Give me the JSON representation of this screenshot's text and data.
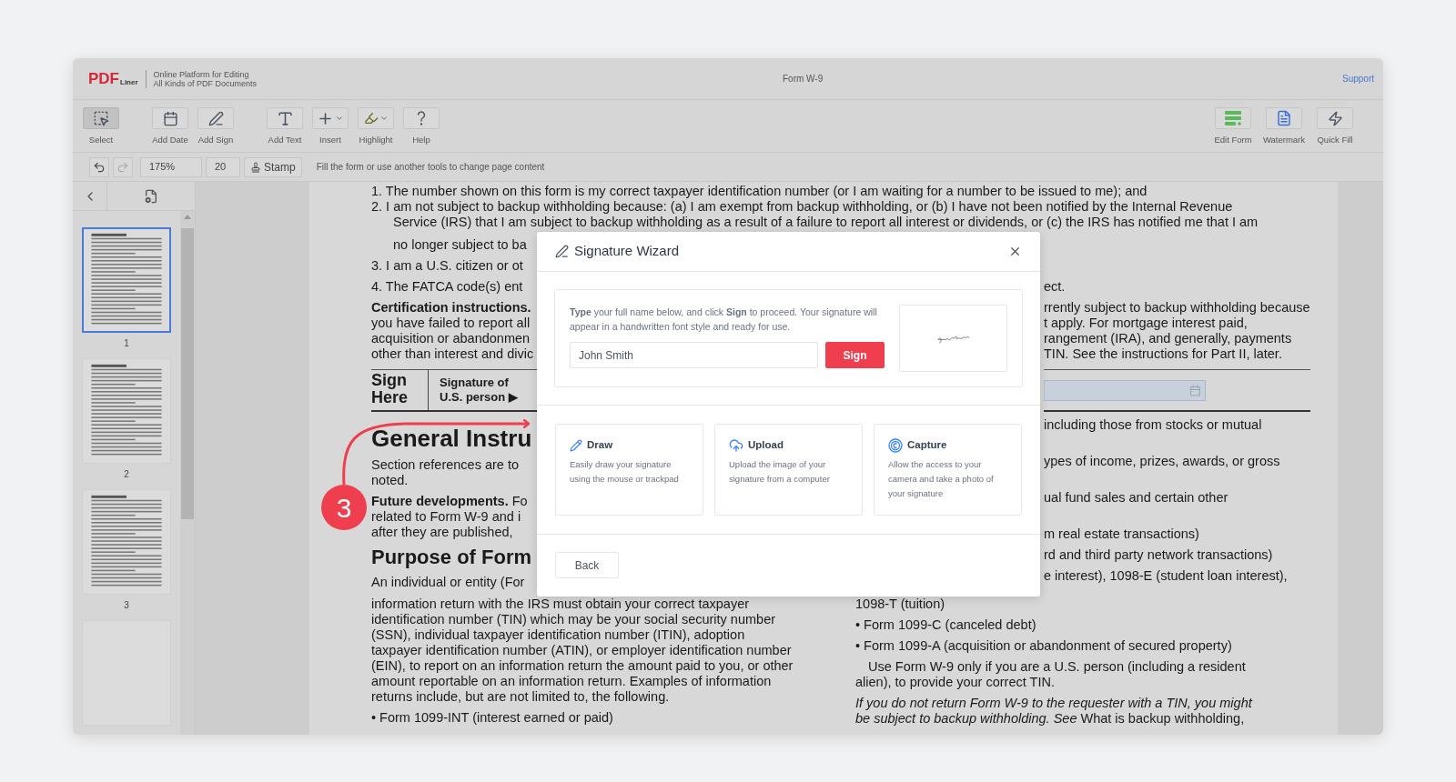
{
  "app": {
    "logo_mark": "PDF",
    "logo_word": "Liner",
    "tagline": "Online Platform for Editing All Kinds of PDF Documents",
    "title": "Form W-9",
    "support": "Support"
  },
  "toolbar": {
    "groups": [
      [
        {
          "label": "Select",
          "selected": true,
          "caret": false
        }
      ],
      [
        {
          "label": "Add Date",
          "selected": false,
          "caret": false
        },
        {
          "label": "Add Sign",
          "selected": false,
          "caret": false
        }
      ],
      [
        {
          "label": "Add Text",
          "selected": false,
          "caret": false
        },
        {
          "label": "Insert",
          "selected": false,
          "caret": true
        },
        {
          "label": "Highlight",
          "selected": false,
          "caret": true
        },
        {
          "label": "Help",
          "selected": false,
          "caret": false
        }
      ]
    ],
    "right_tools": [
      {
        "label": "Edit Form",
        "selected": false,
        "caret": false
      },
      {
        "label": "Watermark",
        "selected": false,
        "caret": false
      },
      {
        "label": "Quick Fill",
        "selected": false,
        "caret": false
      }
    ]
  },
  "subbar": {
    "undo_disabled": false,
    "redo_disabled": true,
    "zoom": "175%",
    "page": "20",
    "stamp": "Stamp",
    "hint": "Fill the form or use another tools to change page content"
  },
  "thumbnails": [
    {
      "label": "1",
      "selected": true
    },
    {
      "label": "2",
      "selected": false
    },
    {
      "label": "3",
      "selected": false
    }
  ],
  "partial_thumbnail": true,
  "document": {
    "top": [
      {
        "kind": "line",
        "text": "1. The number shown on this form is my correct taxpayer identification number (or I am waiting for a number to be issued to me); and"
      },
      {
        "kind": "line",
        "text": "2. I am not subject to backup withholding because: (a) I am exempt from backup withholding, or (b) I have not been notified by the Internal Revenue"
      },
      {
        "kind": "cont",
        "text": "Service (IRS) that I am subject to backup withholding as a result of a failure to report all interest or dividends, or (c) the IRS has notified me that I am"
      }
    ],
    "middle_left": [
      {
        "kind": "cont",
        "text": "no longer subject to ba"
      },
      {
        "kind": "item",
        "text": "3. I am a U.S. citizen or ot"
      },
      {
        "kind": "item",
        "text": "4. The FATCA code(s) ent"
      },
      {
        "kind": "para",
        "text": "**Certification instructions.**"
      },
      {
        "kind": "line",
        "text": "you have failed to report all"
      },
      {
        "kind": "line",
        "text": "acquisition or abandonmen"
      },
      {
        "kind": "line",
        "text": "other than interest and divic"
      },
      {
        "kind": "rule"
      },
      {
        "kind": "sign",
        "sign_label": "Sign Here",
        "person_label": "Signature of U.S. person ▶"
      },
      {
        "kind": "thick_rule"
      },
      {
        "kind": "heading",
        "text": "General Instru"
      },
      {
        "kind": "para",
        "text": "Section references are to"
      },
      {
        "kind": "line",
        "text": "noted."
      },
      {
        "kind": "para",
        "text": "**Future developments.** Fo"
      },
      {
        "kind": "line",
        "text": "related to Form W-9 and i"
      },
      {
        "kind": "line",
        "text": "after they are published,"
      },
      {
        "kind": "subheading",
        "text": "Purpose of Form"
      },
      {
        "kind": "para",
        "text": "An individual or entity (For"
      }
    ],
    "middle_right": [
      {
        "kind": "line",
        "text": "ect."
      },
      {
        "kind": "para",
        "text": "rrently subject to backup withholding because"
      },
      {
        "kind": "line",
        "text": "t apply. For mortgage interest paid,"
      },
      {
        "kind": "line",
        "text": "rangement (IRA), and generally, payments"
      },
      {
        "kind": "line",
        "text": "TIN. See the instructions for Part II, later."
      },
      {
        "kind": "rule"
      },
      {
        "kind": "date_field"
      },
      {
        "kind": "thick_rule"
      },
      {
        "kind": "para",
        "text": "including those from stocks or mutual"
      },
      {
        "kind": "tail",
        "text": "ypes of income, prizes, awards, or gross"
      },
      {
        "kind": "tail",
        "text": "ual fund sales and certain other"
      },
      {
        "kind": "tail",
        "text": "m real estate transactions)"
      },
      {
        "kind": "para",
        "text": "rd and third party network transactions)"
      },
      {
        "kind": "para",
        "text": "e interest), 1098-E (student loan interest),"
      }
    ],
    "bottom_left": [
      {
        "kind": "line",
        "text": "information return with the IRS must obtain your correct taxpayer"
      },
      {
        "kind": "line",
        "text": "identification number (TIN) which may be your social security number"
      },
      {
        "kind": "line",
        "text": "(SSN), individual taxpayer identification number (ITIN), adoption"
      },
      {
        "kind": "line",
        "text": "taxpayer identification number (ATIN), or employer identification number"
      },
      {
        "kind": "line",
        "text": "(EIN), to report on an information return the amount paid to you, or other"
      },
      {
        "kind": "line",
        "text": "amount reportable on an information return. Examples of information"
      },
      {
        "kind": "line",
        "text": "returns include, but are not limited to, the following."
      },
      {
        "kind": "para",
        "text": "• Form 1099-INT (interest earned or paid)"
      }
    ],
    "bottom_right": [
      {
        "kind": "line",
        "text": "1098-T (tuition)"
      },
      {
        "kind": "para",
        "text": "• Form 1099-C (canceled debt)"
      },
      {
        "kind": "para",
        "text": "• Form 1099-A (acquisition or abandonment of secured property)"
      },
      {
        "kind": "indent",
        "text": "Use Form W-9 only if you are a U.S. person (including a resident"
      },
      {
        "kind": "line",
        "text": "alien), to provide your correct TIN."
      },
      {
        "kind": "italic",
        "text": "If you do not return Form W-9 to the requester with a TIN, you might"
      },
      {
        "kind": "line",
        "text": "*be subject to backup withholding. See* What is backup withholding,"
      }
    ]
  },
  "dialog": {
    "title": "Signature Wizard",
    "instructions": "**Type** your full name below, and click **Sign** to proceed. Your signature will appear in a handwritten font style and ready for use.",
    "name_value": "John Smith",
    "sign_button": "Sign",
    "options": [
      {
        "title": "Draw",
        "description": "Easily draw your signature using the mouse or trackpad"
      },
      {
        "title": "Upload",
        "description": "Upload the image of your signature from a computer"
      },
      {
        "title": "Capture",
        "description": "Allow the access to your camera and take a photo of your signature"
      }
    ],
    "back_button": "Back"
  },
  "annotation": {
    "step": "3"
  }
}
